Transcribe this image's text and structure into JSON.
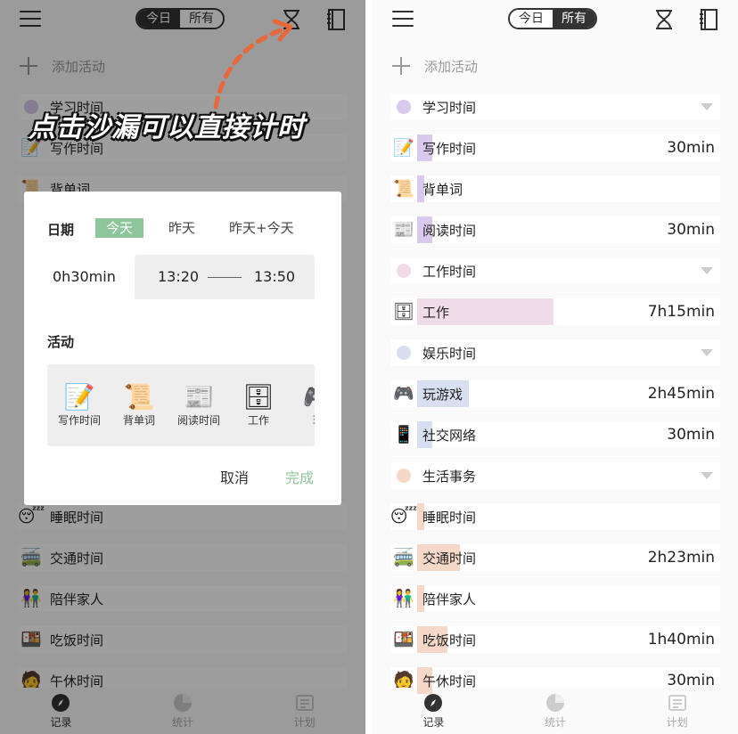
{
  "header": {
    "seg_today": "今日",
    "seg_all": "所有"
  },
  "add_activity": "添加活动",
  "colors": {
    "study": "#d9c9ec",
    "work": "#f0dce8",
    "fun": "#d8dff0",
    "life": "#f5d8c8",
    "accent_green": "#8fc59a",
    "arrow": "#e8683a"
  },
  "right_rows": [
    {
      "type": "group",
      "label": "学习时间",
      "color": "#d9c9ec"
    },
    {
      "type": "item",
      "icon": "memo-icon",
      "glyph": "📝",
      "label": "写作时间",
      "duration": "30min",
      "bar": "#d9c9ec",
      "fill": 0.05
    },
    {
      "type": "item",
      "icon": "scroll-icon",
      "glyph": "📜",
      "label": "背单词",
      "duration": "",
      "bar": "#d9c9ec",
      "fill": 0
    },
    {
      "type": "item",
      "icon": "newspaper-icon",
      "glyph": "📰",
      "label": "阅读时间",
      "duration": "30min",
      "bar": "#d9c9ec",
      "fill": 0.05
    },
    {
      "type": "group",
      "label": "工作时间",
      "color": "#f0dce8"
    },
    {
      "type": "item",
      "icon": "file-cabinet-icon",
      "glyph": "🗄",
      "label": "工作",
      "duration": "7h15min",
      "bar": "#f0dce8",
      "fill": 0.45
    },
    {
      "type": "group",
      "label": "娱乐时间",
      "color": "#d8dff0"
    },
    {
      "type": "item",
      "icon": "gamepad-icon",
      "glyph": "🎮",
      "label": "玩游戏",
      "duration": "2h45min",
      "bar": "#d8dff0",
      "fill": 0.17
    },
    {
      "type": "item",
      "icon": "phone-icon",
      "glyph": "📱",
      "label": "社交网络",
      "duration": "30min",
      "bar": "#d8dff0",
      "fill": 0.05
    },
    {
      "type": "group",
      "label": "生活事务",
      "color": "#f5d8c8"
    },
    {
      "type": "item",
      "icon": "sleepy-face-icon",
      "glyph": "😴",
      "label": "睡眠时间",
      "duration": "",
      "bar": "#f5d8c8",
      "fill": 0
    },
    {
      "type": "item",
      "icon": "trolleybus-icon",
      "glyph": "🚎",
      "label": "交通时间",
      "duration": "2h23min",
      "bar": "#f5d8c8",
      "fill": 0.14
    },
    {
      "type": "item",
      "icon": "family-icon",
      "glyph": "👫",
      "label": "陪伴家人",
      "duration": "",
      "bar": "#f5d8c8",
      "fill": 0
    },
    {
      "type": "item",
      "icon": "bento-icon",
      "glyph": "🍱",
      "label": "吃饭时间",
      "duration": "1h40min",
      "bar": "#f5d8c8",
      "fill": 0.1
    },
    {
      "type": "item",
      "icon": "person-icon",
      "glyph": "🧑",
      "label": "午休时间",
      "duration": "30min",
      "bar": "#f5d8c8",
      "fill": 0.05
    }
  ],
  "left_rows": [
    {
      "type": "group",
      "label": "学习时间",
      "color": "#d9c9ec"
    },
    {
      "type": "item",
      "icon": "memo-icon",
      "glyph": "📝",
      "label": "写作时间"
    },
    {
      "type": "item",
      "icon": "scroll-icon",
      "glyph": "📜",
      "label": "背单词"
    },
    {
      "type": "item",
      "icon": "sleepy-face-icon",
      "glyph": "😴",
      "label": "睡眠时间"
    },
    {
      "type": "item",
      "icon": "trolleybus-icon",
      "glyph": "🚎",
      "label": "交通时间"
    },
    {
      "type": "item",
      "icon": "family-icon",
      "glyph": "👫",
      "label": "陪伴家人"
    },
    {
      "type": "item",
      "icon": "bento-icon",
      "glyph": "🍱",
      "label": "吃饭时间"
    },
    {
      "type": "item",
      "icon": "person-icon",
      "glyph": "🧑",
      "label": "午休时间"
    }
  ],
  "caption": "点击沙漏可以直接计时",
  "dialog": {
    "date_label": "日期",
    "date_options": [
      "今天",
      "昨天",
      "昨天+今天"
    ],
    "duration": "0h30min",
    "start": "13:20",
    "end": "13:50",
    "activity_label": "活动",
    "activities": [
      {
        "glyph": "📝",
        "icon": "memo-icon",
        "label": "写作时间"
      },
      {
        "glyph": "📜",
        "icon": "scroll-icon",
        "label": "背单词"
      },
      {
        "glyph": "📰",
        "icon": "newspaper-icon",
        "label": "阅读时间"
      },
      {
        "glyph": "🗄",
        "icon": "file-cabinet-icon",
        "label": "工作"
      },
      {
        "glyph": "🎮",
        "icon": "gamepad-icon",
        "label": "玩"
      }
    ],
    "cancel": "取消",
    "done": "完成"
  },
  "nav": {
    "record": "记录",
    "stats": "统计",
    "plan": "计划"
  }
}
